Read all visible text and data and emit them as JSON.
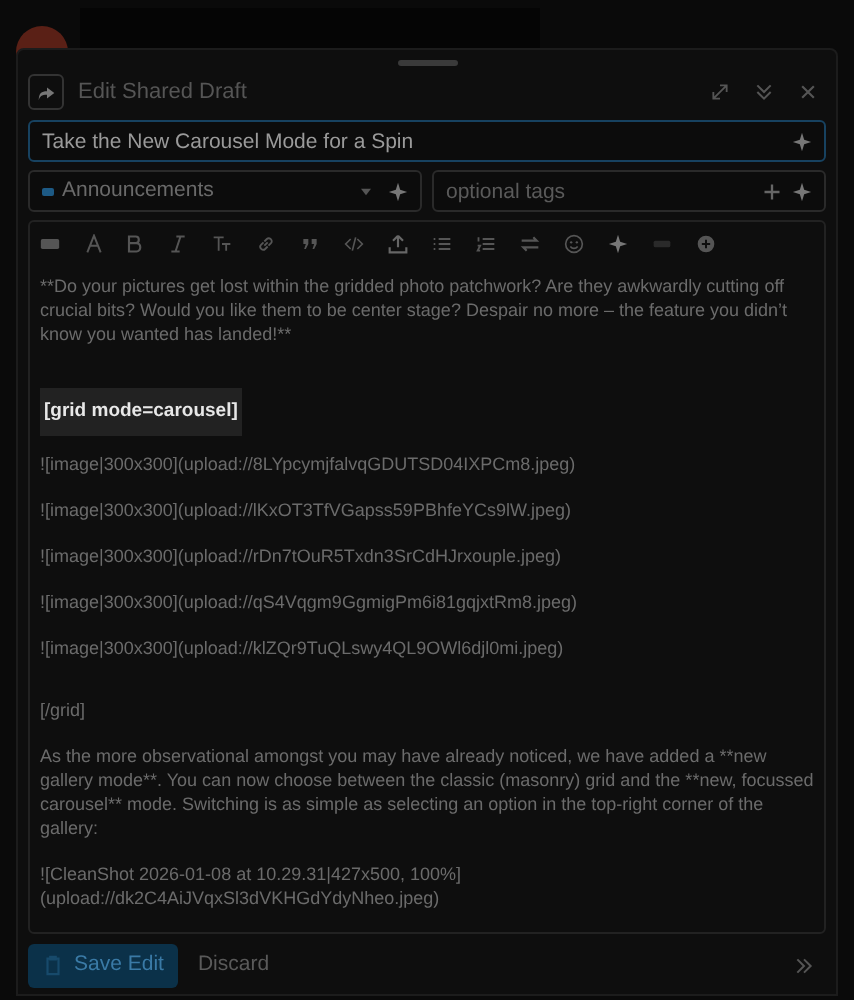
{
  "composer": {
    "title": "Edit Shared Draft"
  },
  "topic_title": {
    "value": "Take the New Carousel Mode for a Spin",
    "focused": true
  },
  "category": {
    "label": "Announcements",
    "color": "#1d5a85"
  },
  "tags": {
    "placeholder": "optional tags"
  },
  "editor_lines": [
    {
      "kind": "text",
      "text": "**Do your pictures get lost within the gridded photo patchwork? Are they awkwardly cutting off crucial bits? Would you like them to be center stage? Despair no more – the feature you didn’t know you wanted has landed!**"
    },
    {
      "kind": "spacer"
    },
    {
      "kind": "highlight",
      "text": "[grid mode=carousel]"
    },
    {
      "kind": "text",
      "text": "![image|300x300](upload://8LYpcymjfalvqGDUTSD04IXPCm8.jpeg)"
    },
    {
      "kind": "text",
      "text": "![image|300x300](upload://lKxOT3TfVGapss59PBhfeYCs9lW.jpeg)"
    },
    {
      "kind": "text",
      "text": "![image|300x300](upload://rDn7tOuR5Txdn3SrCdHJrxouple.jpeg)"
    },
    {
      "kind": "text",
      "text": "![image|300x300](upload://qS4Vqgm9GgmigPm6i81gqjxtRm8.jpeg)"
    },
    {
      "kind": "text",
      "text": "![image|300x300](upload://klZQr9TuQLswy4QL9OWl6djl0mi.jpeg)"
    },
    {
      "kind": "spacer"
    },
    {
      "kind": "text",
      "text": "[/grid]"
    },
    {
      "kind": "text",
      "text": "As the more observational amongst you may have already noticed, we have added a **new gallery mode**. You can now choose between the classic (masonry) grid and the **new, focussed carousel** mode. Switching is as simple as selecting an option in the top-right corner of the gallery:"
    },
    {
      "kind": "text",
      "text": "![CleanShot 2026-01-08 at 10.29.31|427x500, 100%]\n(upload://dk2C4AiJVqxSl3dVKHGdYdyNheo.jpeg)"
    }
  ],
  "actions": {
    "save": "Save Edit",
    "discard": "Discard"
  }
}
